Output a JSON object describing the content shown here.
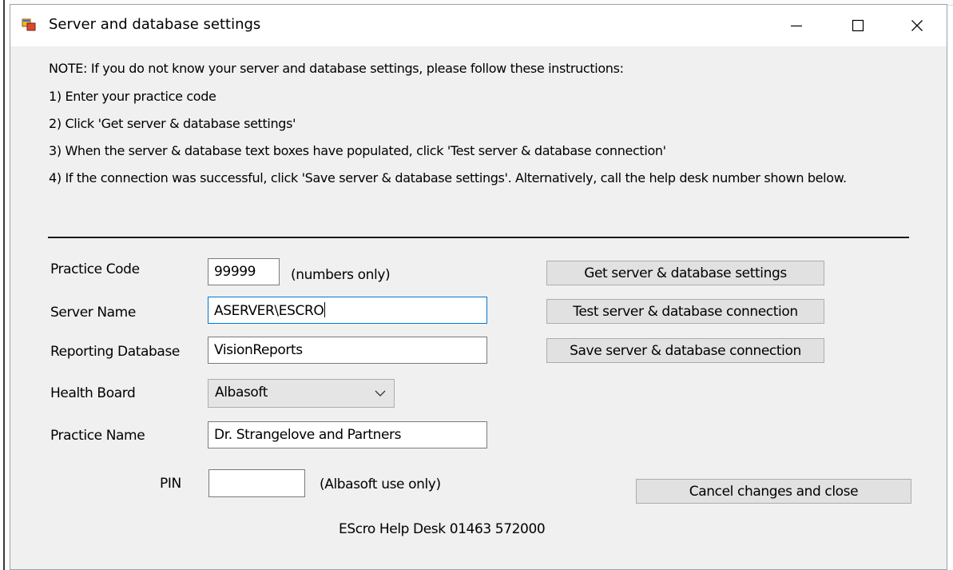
{
  "window": {
    "title": "Server and database settings",
    "controls": {
      "minimize": "minimize-icon",
      "maximize": "maximize-icon",
      "close": "close-icon"
    }
  },
  "instructions": {
    "note": "NOTE: If you do not know your server and database settings, please follow these instructions:",
    "steps": [
      "1) Enter your practice code",
      "2) Click 'Get server & database settings'",
      "3) When the server & database text boxes have populated, click 'Test server & database connection'",
      "4) If the connection was successful, click 'Save server & database settings'. Alternatively, call the help desk number shown below."
    ]
  },
  "form": {
    "practice_code": {
      "label": "Practice Code",
      "value": "99999",
      "hint": "(numbers only)"
    },
    "server_name": {
      "label": "Server Name",
      "value": "ASERVER\\ESCRO"
    },
    "reporting_database": {
      "label": "Reporting Database",
      "value": "VisionReports"
    },
    "health_board": {
      "label": "Health Board",
      "selected": "Albasoft"
    },
    "practice_name": {
      "label": "Practice Name",
      "value": "Dr. Strangelove and Partners"
    },
    "pin": {
      "label": "PIN",
      "value": "",
      "hint": "(Albasoft use only)"
    }
  },
  "buttons": {
    "get_settings": "Get server & database settings",
    "test_connection": "Test server & database connection",
    "save_connection": "Save server & database connection",
    "cancel_close": "Cancel changes and close"
  },
  "footer": {
    "help_desk": "EScro Help Desk 01463 572000"
  },
  "colors": {
    "window_bg": "#f0f0f0",
    "focus_border": "#0078d7",
    "button_bg": "#e1e1e1",
    "combo_bg": "#e5e5e5"
  }
}
